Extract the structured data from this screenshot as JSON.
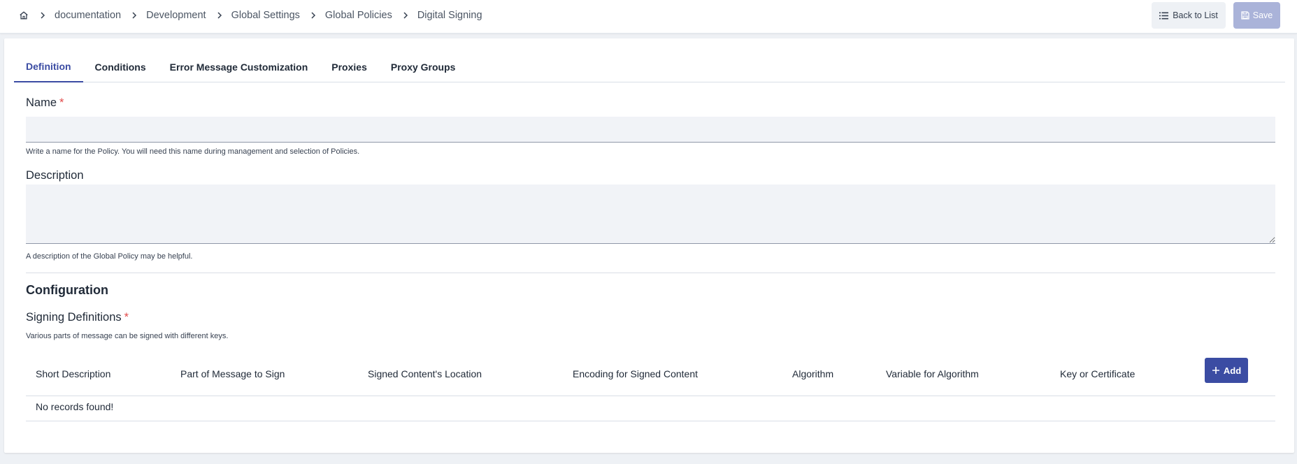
{
  "breadcrumb": {
    "home_icon": "home-icon",
    "items": [
      "documentation",
      "Development",
      "Global Settings",
      "Global Policies",
      "Digital Signing"
    ]
  },
  "toolbar": {
    "back_label": "Back to List",
    "back_icon": "list-icon",
    "save_label": "Save",
    "save_icon": "floppy-disk-icon",
    "save_enabled": false
  },
  "tabs": [
    {
      "label": "Definition",
      "active": true
    },
    {
      "label": "Conditions",
      "active": false
    },
    {
      "label": "Error Message Customization",
      "active": false
    },
    {
      "label": "Proxies",
      "active": false
    },
    {
      "label": "Proxy Groups",
      "active": false
    }
  ],
  "form": {
    "name": {
      "label": "Name",
      "required_mark": "*",
      "value": "",
      "help": "Write a name for the Policy. You will need this name during management and selection of Policies."
    },
    "description": {
      "label": "Description",
      "value": "",
      "help": "A description of the Global Policy may be helpful."
    }
  },
  "configuration": {
    "title": "Configuration",
    "signing_definitions": {
      "label": "Signing Definitions",
      "required_mark": "*",
      "help": "Various parts of message can be signed with different keys.",
      "columns": [
        "Short Description",
        "Part of Message to Sign",
        "Signed Content's Location",
        "Encoding for Signed Content",
        "Algorithm",
        "Variable for Algorithm",
        "Key or Certificate"
      ],
      "add_label": "Add",
      "add_icon": "plus-icon",
      "empty_text": "No records found!"
    }
  },
  "colors": {
    "accent": "#3b4ca3",
    "required": "#e24b4b",
    "save_disabled": "#aab3d9"
  }
}
